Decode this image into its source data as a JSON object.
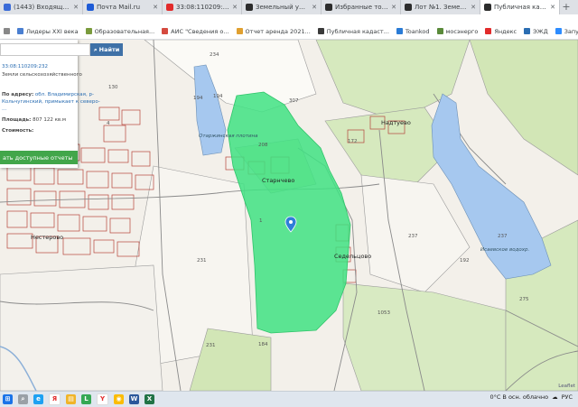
{
  "tabs": [
    {
      "label": "(1443) Входящие - Почта",
      "color": "#3a6bd8"
    },
    {
      "label": "Почта Mail.ru",
      "color": "#1e5bd6"
    },
    {
      "label": "33:08:110209:232 — Яндекс",
      "color": "#e22b2b"
    },
    {
      "label": "Земельный участок кадастровый",
      "color": "#2c2c2c"
    },
    {
      "label": "Избранные торги и лоты",
      "color": "#2c2c2c"
    },
    {
      "label": "Лот №1. Земельный участок",
      "color": "#2c2c2c"
    },
    {
      "label": "Публичная кадастровая карта",
      "color": "#2c2c2c"
    }
  ],
  "bookmarks": [
    {
      "label": "Лидеры XXI века",
      "color": "#4a7fd1"
    },
    {
      "label": "Образовательная...",
      "color": "#7a9b3d"
    },
    {
      "label": "АИС \"Сведения о...",
      "color": "#d54a3f"
    },
    {
      "label": "Отчет аренда 2021...",
      "color": "#e0a030"
    },
    {
      "label": "Публичная кадаст...",
      "color": "#3a3a3a"
    },
    {
      "label": "Toankod",
      "color": "#2a7bd6"
    },
    {
      "label": "мосэнерго",
      "color": "#5a8a3a"
    },
    {
      "label": "Яндекс",
      "color": "#e22b2b"
    },
    {
      "label": "ЭЖД",
      "color": "#2a6db2"
    },
    {
      "label": "Запустить конфере...",
      "color": "#2d8cff"
    },
    {
      "label": "Meet",
      "color": "#1a9e5c"
    },
    {
      "label": "контур",
      "color": "#333333"
    },
    {
      "label": "YouTube",
      "color": "#e22b2b"
    }
  ],
  "panel": {
    "search_value": "",
    "search_button": "Найти",
    "cadastral_number": "33:08:110209:232",
    "category": "Земли сельскохозяйственного",
    "address_label": "По адресу:",
    "address_text": "обл. Владимирская, р-",
    "address_line2": "Кольчугинский, примыкает к северо-",
    "address_line3": "...",
    "area_label": "Площадь:",
    "area_value": "807 122 кв.м",
    "cost_label": "Стоимость:",
    "cost_value": "",
    "action_button": "ать доступные отчеты"
  },
  "map_labels": {
    "parcels": [
      "234",
      "307",
      "194",
      "208",
      "172",
      "1",
      "231",
      "1053",
      "275",
      "237",
      "231",
      "184",
      "237",
      "194",
      "130",
      "4",
      "192"
    ],
    "places": [
      {
        "text": "Старнчево"
      },
      {
        "text": "Надтуево"
      },
      {
        "text": "Седельцово"
      },
      {
        "text": "Нестерово"
      }
    ],
    "water": [
      {
        "text": "Отаржинская плотина"
      },
      {
        "text": "Исаевское водохр."
      }
    ],
    "corner_label": "Leaflet"
  },
  "taskbar": {
    "weather": "0°C  В осн. облачно",
    "lang": "РУС",
    "icons": [
      "windows-icon",
      "search-icon",
      "edge-icon",
      "yandex-icon",
      "file-icon",
      "lens-icon",
      "yandex-browser-icon",
      "chrome-icon",
      "word-icon",
      "excel-icon"
    ]
  },
  "colors": {
    "parcel_fill": "#3fe283",
    "water": "#a6c8ef",
    "forest": "#d2e6b6"
  }
}
